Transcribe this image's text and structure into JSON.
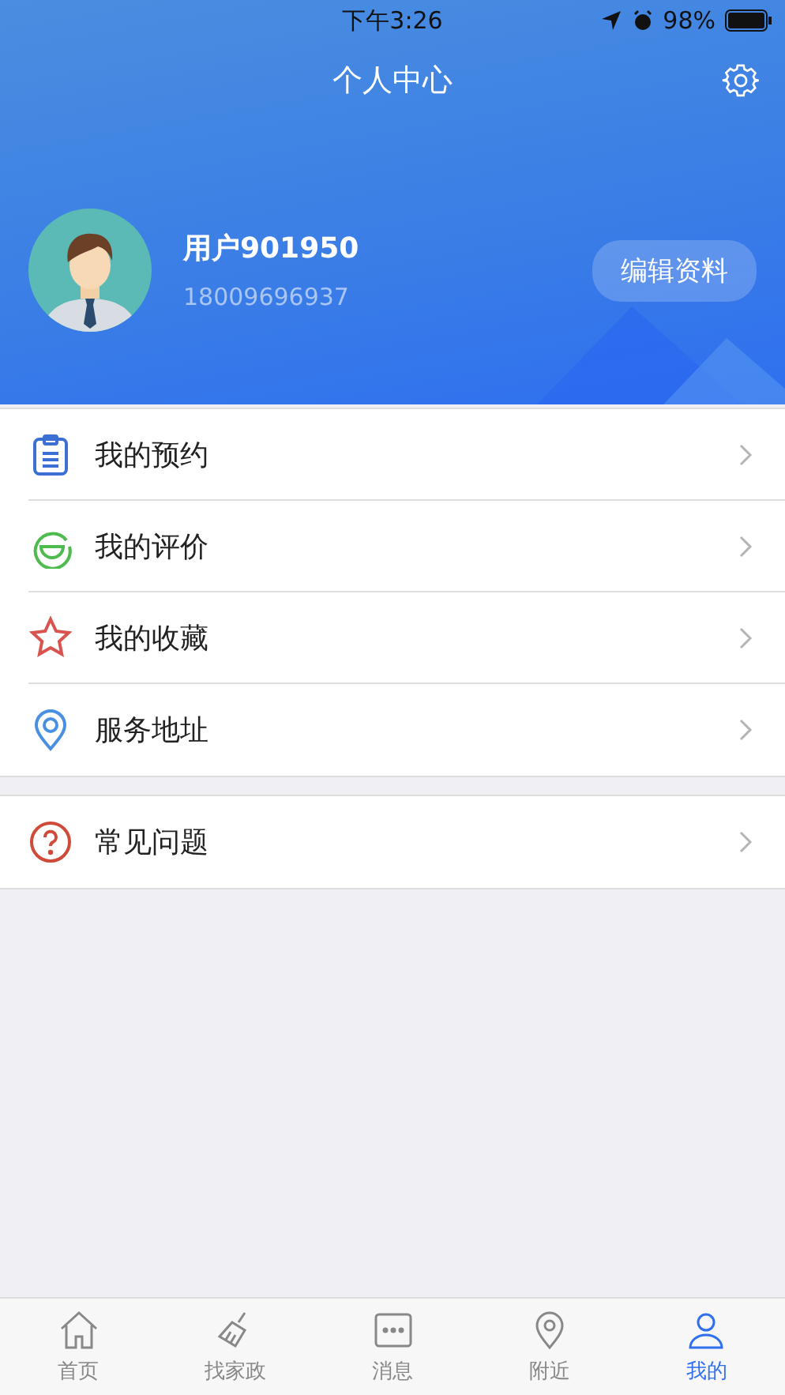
{
  "status_bar": {
    "time": "下午3:26",
    "battery_text": "98%"
  },
  "header": {
    "title": "个人中心"
  },
  "profile": {
    "name": "用户901950",
    "phone": "18009696937",
    "edit_button": "编辑资料"
  },
  "menu_groups": [
    {
      "items": [
        {
          "kind": "clipboard",
          "label": "我的预约"
        },
        {
          "kind": "smile",
          "label": "我的评价"
        },
        {
          "kind": "star",
          "label": "我的收藏"
        },
        {
          "kind": "pin",
          "label": "服务地址"
        }
      ]
    },
    {
      "items": [
        {
          "kind": "question",
          "label": "常见问题"
        }
      ]
    }
  ],
  "tabs": [
    {
      "kind": "home",
      "label": "首页",
      "selected": false
    },
    {
      "kind": "brush",
      "label": "找家政",
      "selected": false
    },
    {
      "kind": "chat",
      "label": "消息",
      "selected": false
    },
    {
      "kind": "pin",
      "label": "附近",
      "selected": false
    },
    {
      "kind": "person",
      "label": "我的",
      "selected": true
    }
  ]
}
